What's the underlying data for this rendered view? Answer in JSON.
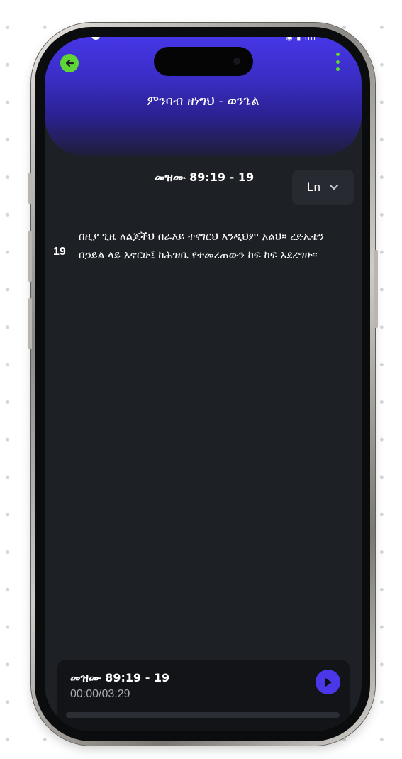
{
  "header": {
    "title": "ምንባብ ዘነግህ - ወንጌል",
    "back_icon": "arrow-left-icon",
    "menu_icon": "kebab-menu-icon",
    "accent": "#5fd636",
    "gradient_top": "#4636e6",
    "gradient_bottom": "#1f1e38"
  },
  "chapter": {
    "reference": "መዝሙ 89:19 - 19"
  },
  "language_select": {
    "value": "Ln",
    "icon": "chevron-down-icon"
  },
  "verses": [
    {
      "number": "19",
      "text": "በዚያ ጊዜ ለልጆችህ በራእይ ተናገርህ እንዲህም አልህ። ረድኤቴን በኃይል ላይ አኖርሁ፤ ከሕዝቤ የተመረጠውን ከፍ ከፍ አደረግሁ።"
    }
  ],
  "player": {
    "title": "መዝሙ 89:19 - 19",
    "time": "00:00/03:29",
    "progress": 0,
    "play_icon": "play-icon",
    "accent": "#4a37e8"
  }
}
